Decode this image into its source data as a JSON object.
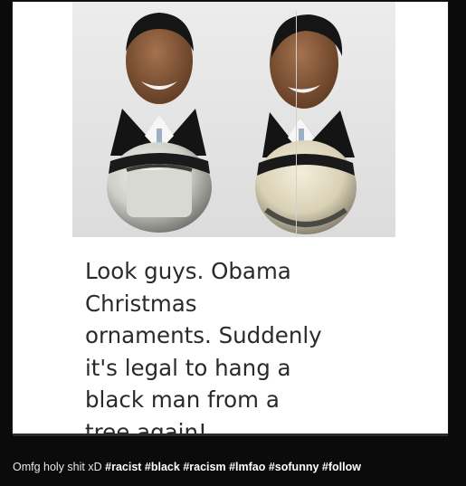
{
  "meme": {
    "lines": [
      "Look guys. Obama",
      "Christmas",
      "ornaments. Suddenly",
      "it's legal to hang a",
      "black man from a",
      "tree again!"
    ]
  },
  "caption": {
    "text": "Omfg holy shit xD",
    "tags": [
      "#racist",
      "#black",
      "#racism",
      "#lmfao",
      "#sofunny",
      "#follow"
    ]
  }
}
